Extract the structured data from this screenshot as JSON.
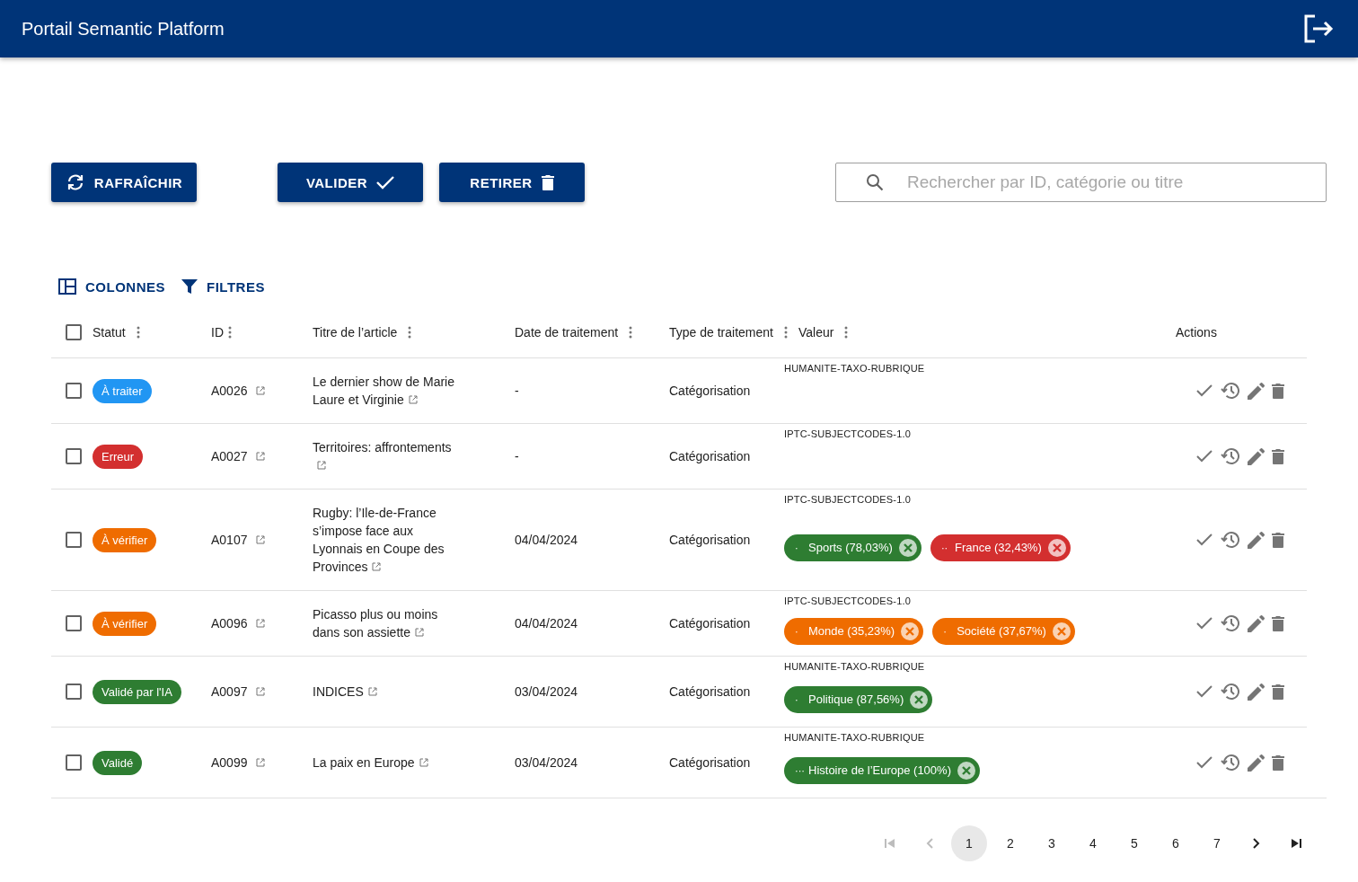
{
  "app_bar": {
    "title": "Portail Semantic Platform"
  },
  "toolbar": {
    "buttons": [
      {
        "label": "RAFRAÎCHIR",
        "kind": "refresh"
      },
      {
        "label": "VALIDER",
        "kind": "validate"
      },
      {
        "label": "RETIRER",
        "kind": "remove"
      }
    ],
    "search": {
      "placeholder": "Rechercher par ID, catégorie ou titre"
    }
  },
  "grid_toolbar": [
    {
      "label": "COLONNES",
      "kind": "columns"
    },
    {
      "label": "FILTRES",
      "kind": "filter"
    }
  ],
  "table": {
    "select_all": {
      "checked": false
    },
    "columns": [
      {
        "label": "Statut",
        "kind": "menu"
      },
      {
        "label": "ID",
        "kind": "menu"
      },
      {
        "label": "Titre de l’article",
        "kind": "menu"
      },
      {
        "label": "Date de traitement",
        "kind": "menu"
      },
      {
        "label": "Type de traitement",
        "kind": "menu"
      },
      {
        "label": "Valeur",
        "kind": "menu"
      },
      {
        "label": "Actions",
        "kind": "plain"
      }
    ],
    "rows": [
      {
        "checked": false,
        "status": {
          "label": "À traiter",
          "color": "#2196f3"
        },
        "id": "A0026",
        "title": "Le dernier show de Marie Laure et Virginie",
        "date": "-",
        "type": "Catégorisation",
        "taxonomy": "HUMANITE-TAXO-RUBRIQUE",
        "tags": []
      },
      {
        "checked": false,
        "status": {
          "label": "Erreur",
          "color": "#d32f2f"
        },
        "id": "A0027",
        "title": "Territoires: affrontements",
        "date": "-",
        "type": "Catégorisation",
        "taxonomy": "IPTC-SUBJECTCODES-1.0",
        "tags": []
      },
      {
        "checked": false,
        "status": {
          "label": "À vérifier",
          "color": "#ef6c00"
        },
        "id": "A0107",
        "title": "Rugby: l’Ile-de-France s’impose face aux Lyonnais en Coupe des Provinces",
        "date": "04/04/2024",
        "type": "Catégorisation",
        "taxonomy": "IPTC-SUBJECTCODES-1.0",
        "tags": [
          {
            "marker": "·",
            "label": "Sports (78,03%)",
            "color": "#2e7d32"
          },
          {
            "marker": "··",
            "label": "France (32,43%)",
            "color": "#d32f2f"
          }
        ]
      },
      {
        "checked": false,
        "status": {
          "label": "À vérifier",
          "color": "#ef6c00"
        },
        "id": "A0096",
        "title": "Picasso plus ou moins dans son assiette",
        "date": "04/04/2024",
        "type": "Catégorisation",
        "taxonomy": "IPTC-SUBJECTCODES-1.0",
        "tags": [
          {
            "marker": "·",
            "label": "Monde (35,23%)",
            "color": "#ef6c00"
          },
          {
            "marker": "·",
            "label": "Société (37,67%)",
            "color": "#ef6c00"
          }
        ]
      },
      {
        "checked": false,
        "status": {
          "label": "Validé par l'IA",
          "color": "#2e7d32"
        },
        "id": "A0097",
        "title": "INDICES",
        "date": "03/04/2024",
        "type": "Catégorisation",
        "taxonomy": "HUMANITE-TAXO-RUBRIQUE",
        "tags": [
          {
            "marker": "·",
            "label": "Politique (87,56%)",
            "color": "#2e7d32"
          }
        ]
      },
      {
        "checked": false,
        "status": {
          "label": "Validé",
          "color": "#2e7d32"
        },
        "id": "A0099",
        "title": "La paix en Europe",
        "date": "03/04/2024",
        "type": "Catégorisation",
        "taxonomy": "HUMANITE-TAXO-RUBRIQUE",
        "tags": [
          {
            "marker": "···",
            "label": "Histoire de l’Europe (100%)",
            "color": "#2e7d32"
          }
        ]
      }
    ]
  },
  "pagination": {
    "first_disabled": true,
    "prev_disabled": true,
    "next_disabled": false,
    "last_disabled": false,
    "pages": [
      {
        "label": "1",
        "selected": true
      },
      {
        "label": "2",
        "selected": false
      },
      {
        "label": "3",
        "selected": false
      },
      {
        "label": "4",
        "selected": false
      },
      {
        "label": "5",
        "selected": false
      },
      {
        "label": "6",
        "selected": false
      },
      {
        "label": "7",
        "selected": false
      }
    ]
  }
}
